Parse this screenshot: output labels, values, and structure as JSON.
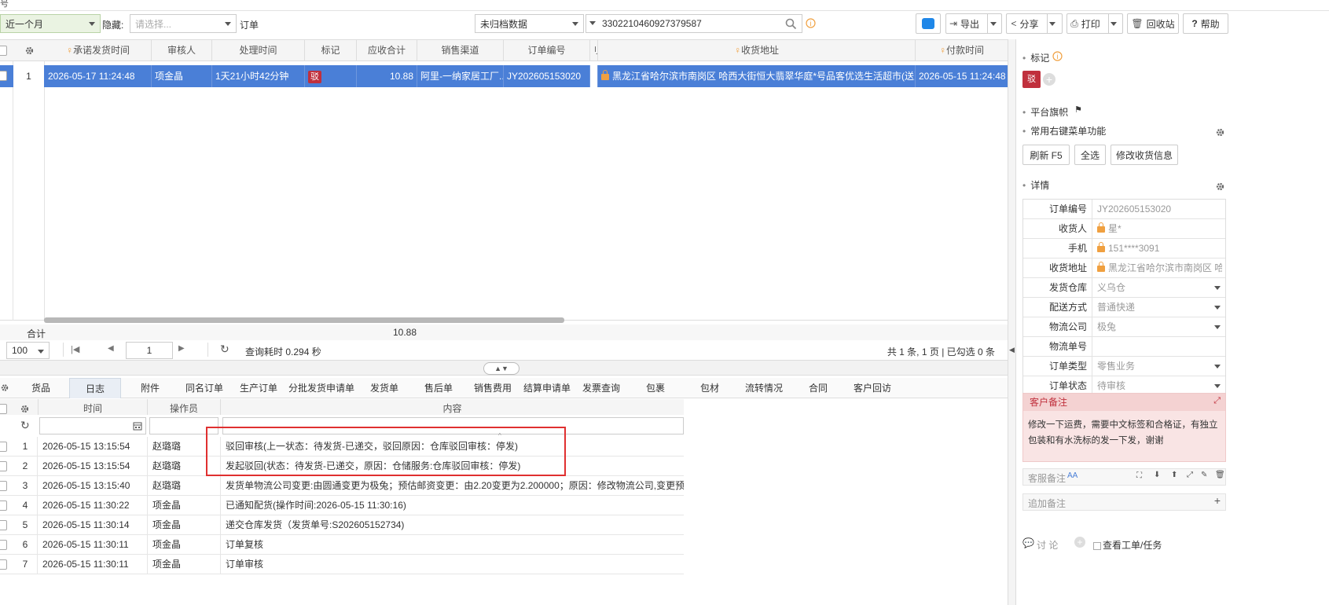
{
  "toolbar": {
    "tab_fragment": "号",
    "period": "近一个月",
    "hide_label": "隐藏:",
    "hide_placeholder": "请选择...",
    "order_label": "订单",
    "archive_filter": "未归档数据",
    "search_value": "3302210460927379587",
    "export_label": "导出",
    "share_label": "分享",
    "print_label": "打印",
    "recycle_label": "回收站",
    "help_label": "帮助"
  },
  "grid": {
    "headers": [
      "承诺发货时间",
      "审核人",
      "处理时间",
      "标记",
      "应收合计",
      "销售渠道",
      "订单编号",
      "刂",
      "收货地址",
      "付款时间"
    ],
    "row": {
      "index": "1",
      "promise_time": "2026-05-17 11:24:48",
      "reviewer": "项金晶",
      "process_time": "1天21小时42分钟",
      "mark": "驳",
      "amount": "10.88",
      "channel": "阿里-一纳家居工厂...",
      "order_no": "JY202605153020",
      "address": "黑龙江省哈尔滨市南岗区 哈西大街恒大翡翠华庭*号品客优选生活超市(送到...",
      "pay_time": "2026-05-15 11:24:48"
    },
    "total_label": "合计",
    "total_value": "10.88"
  },
  "pager": {
    "page_size": "100",
    "page": "1",
    "query_time": "查询耗时 0.294 秒",
    "summary": "共 1 条, 1 页 | 已勾选 0 条"
  },
  "tabs": [
    "货品",
    "日志",
    "附件",
    "同名订单",
    "生产订单",
    "分批发货申请单",
    "发货单",
    "售后单",
    "销售费用",
    "结算申请单",
    "发票查询",
    "包裹",
    "包材",
    "流转情况",
    "合同",
    "客户回访"
  ],
  "log": {
    "headers": [
      "时间",
      "操作员",
      "内容"
    ],
    "rows": [
      {
        "no": "1",
        "time": "2026-05-15 13:15:54",
        "op": "赵璐璐",
        "content": "驳回审核(上一状态：待发货-已递交，驳回原因：仓库驳回审核：停发)"
      },
      {
        "no": "2",
        "time": "2026-05-15 13:15:54",
        "op": "赵璐璐",
        "content": "发起驳回(状态：待发货-已递交，原因：仓储服务:仓库驳回审核：停发)"
      },
      {
        "no": "3",
        "time": "2026-05-15 13:15:40",
        "op": "赵璐璐",
        "content": "发货单物流公司变更:由圆通变更为极兔；预估邮资变更：由2.20变更为2.200000；原因：修改物流公司,变更预估邮资"
      },
      {
        "no": "4",
        "time": "2026-05-15 11:30:22",
        "op": "项金晶",
        "content": "已通知配货(操作时间:2026-05-15 11:30:16)"
      },
      {
        "no": "5",
        "time": "2026-05-15 11:30:14",
        "op": "项金晶",
        "content": "递交仓库发货（发货单号:S202605152734)"
      },
      {
        "no": "6",
        "time": "2026-05-15 11:30:11",
        "op": "项金晶",
        "content": "订单复核"
      },
      {
        "no": "7",
        "time": "2026-05-15 11:30:11",
        "op": "项金晶",
        "content": "订单审核"
      }
    ]
  },
  "panel": {
    "mark_title": "标记",
    "mark_tag": "驳",
    "platform_flag": "平台旗帜",
    "context_menu": "常用右键菜单功能",
    "btn_refresh": "刷新  F5",
    "btn_select_all": "全选",
    "btn_edit_address": "修改收货信息",
    "detail_title": "详情",
    "details": [
      {
        "k": "订单编号",
        "v": "JY202605153020",
        "lock": false,
        "caret": false
      },
      {
        "k": "收货人",
        "v": "星*",
        "lock": true,
        "caret": false
      },
      {
        "k": "手机",
        "v": "151****3091",
        "lock": true,
        "caret": false
      },
      {
        "k": "收货地址",
        "v": "黑龙江省哈尔滨市南岗区 哈西",
        "lock": true,
        "caret": false
      },
      {
        "k": "发货仓库",
        "v": "义乌仓",
        "lock": false,
        "caret": true
      },
      {
        "k": "配送方式",
        "v": "普通快递",
        "lock": false,
        "caret": true
      },
      {
        "k": "物流公司",
        "v": "极兔",
        "lock": false,
        "caret": true
      },
      {
        "k": "物流单号",
        "v": "",
        "lock": false,
        "caret": false
      },
      {
        "k": "订单类型",
        "v": "零售业务",
        "lock": false,
        "caret": true
      },
      {
        "k": "订单状态",
        "v": "待审核",
        "lock": false,
        "caret": true
      }
    ],
    "customer_note_title": "客户备注",
    "customer_note": "修改一下运费，需要中文标签和合格证，有独立包装和有水洗标的发一下发，谢谢",
    "service_note": "客服备注",
    "service_note_font": "AA",
    "add_note": "追加备注",
    "discuss": "讨 论",
    "view_ticket": "查看工单/任务"
  },
  "colors": {
    "selected_row": "#4a7fd7",
    "note_bg": "#f9e4e4",
    "tag_red": "#c0303d",
    "highlight_box": "#e03030"
  }
}
